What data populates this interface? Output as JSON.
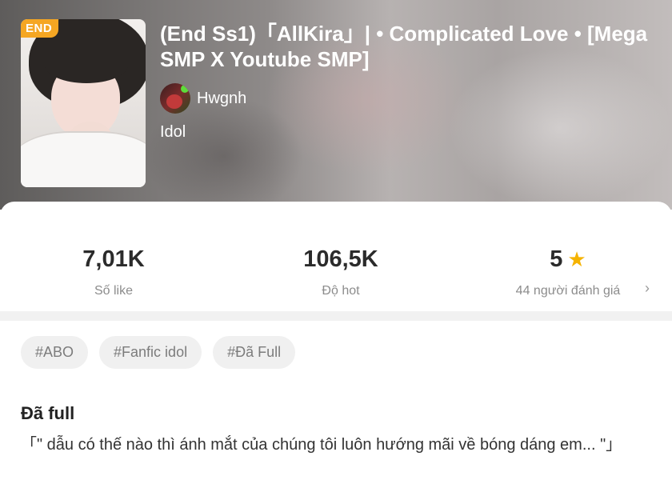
{
  "book": {
    "badge": "END",
    "title": "(End Ss1)「AllKira」| • Complicated Love • [Mega SMP X Youtube SMP]",
    "author": "Hwgnh",
    "genre": "Idol"
  },
  "stats": {
    "likes": {
      "value": "7,01K",
      "label": "Số like"
    },
    "hot": {
      "value": "106,5K",
      "label": "Độ hot"
    },
    "rating": {
      "value": "5",
      "label": "44 người đánh giá",
      "icon": "star-icon"
    }
  },
  "tags": [
    "#ABO",
    "#Fanfic idol",
    "#Đã Full"
  ],
  "description": {
    "heading": "Đã full",
    "text": "「\" dẫu có thế nào thì ánh mắt của chúng tôi luôn hướng mãi về bóng dáng em... \"」"
  },
  "colors": {
    "accent": "#f5a623",
    "star": "#f5b300"
  }
}
